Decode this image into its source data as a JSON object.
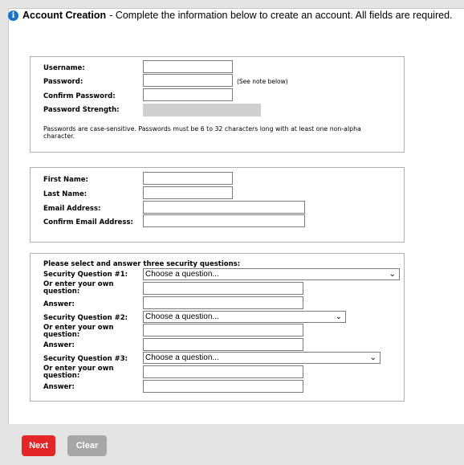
{
  "header": {
    "icon": "info-icon",
    "title": "Account Creation",
    "description": "- Complete the information below to create an account. All fields are required."
  },
  "credentials": {
    "username_label": "Username:",
    "password_label": "Password:",
    "password_note": "(See note below)",
    "confirm_password_label": "Confirm Password:",
    "strength_label": "Password Strength:",
    "rules_text": "Passwords are case-sensitive. Passwords must be 6 to 32 characters long with at least one non-alpha character."
  },
  "personal": {
    "first_name_label": "First Name:",
    "last_name_label": "Last Name:",
    "email_label": "Email Address:",
    "confirm_email_label": "Confirm Email Address:"
  },
  "security": {
    "heading": "Please select and answer three security questions:",
    "questions": [
      {
        "label": "Security Question #1:",
        "select_value": "Choose a question...",
        "own_label": "Or enter your own question:",
        "answer_label": "Answer:"
      },
      {
        "label": "Security Question #2:",
        "select_value": "Choose a question...",
        "own_label": "Or enter your own question:",
        "answer_label": "Answer:"
      },
      {
        "label": "Security Question #3:",
        "select_value": "Choose a question...",
        "own_label": "Or enter your own question:",
        "answer_label": "Answer:"
      }
    ]
  },
  "buttons": {
    "next_label": "Next",
    "clear_label": "Clear"
  },
  "colors": {
    "next": "#e32626",
    "clear": "#a7a7a7",
    "info": "#1a73c7"
  }
}
